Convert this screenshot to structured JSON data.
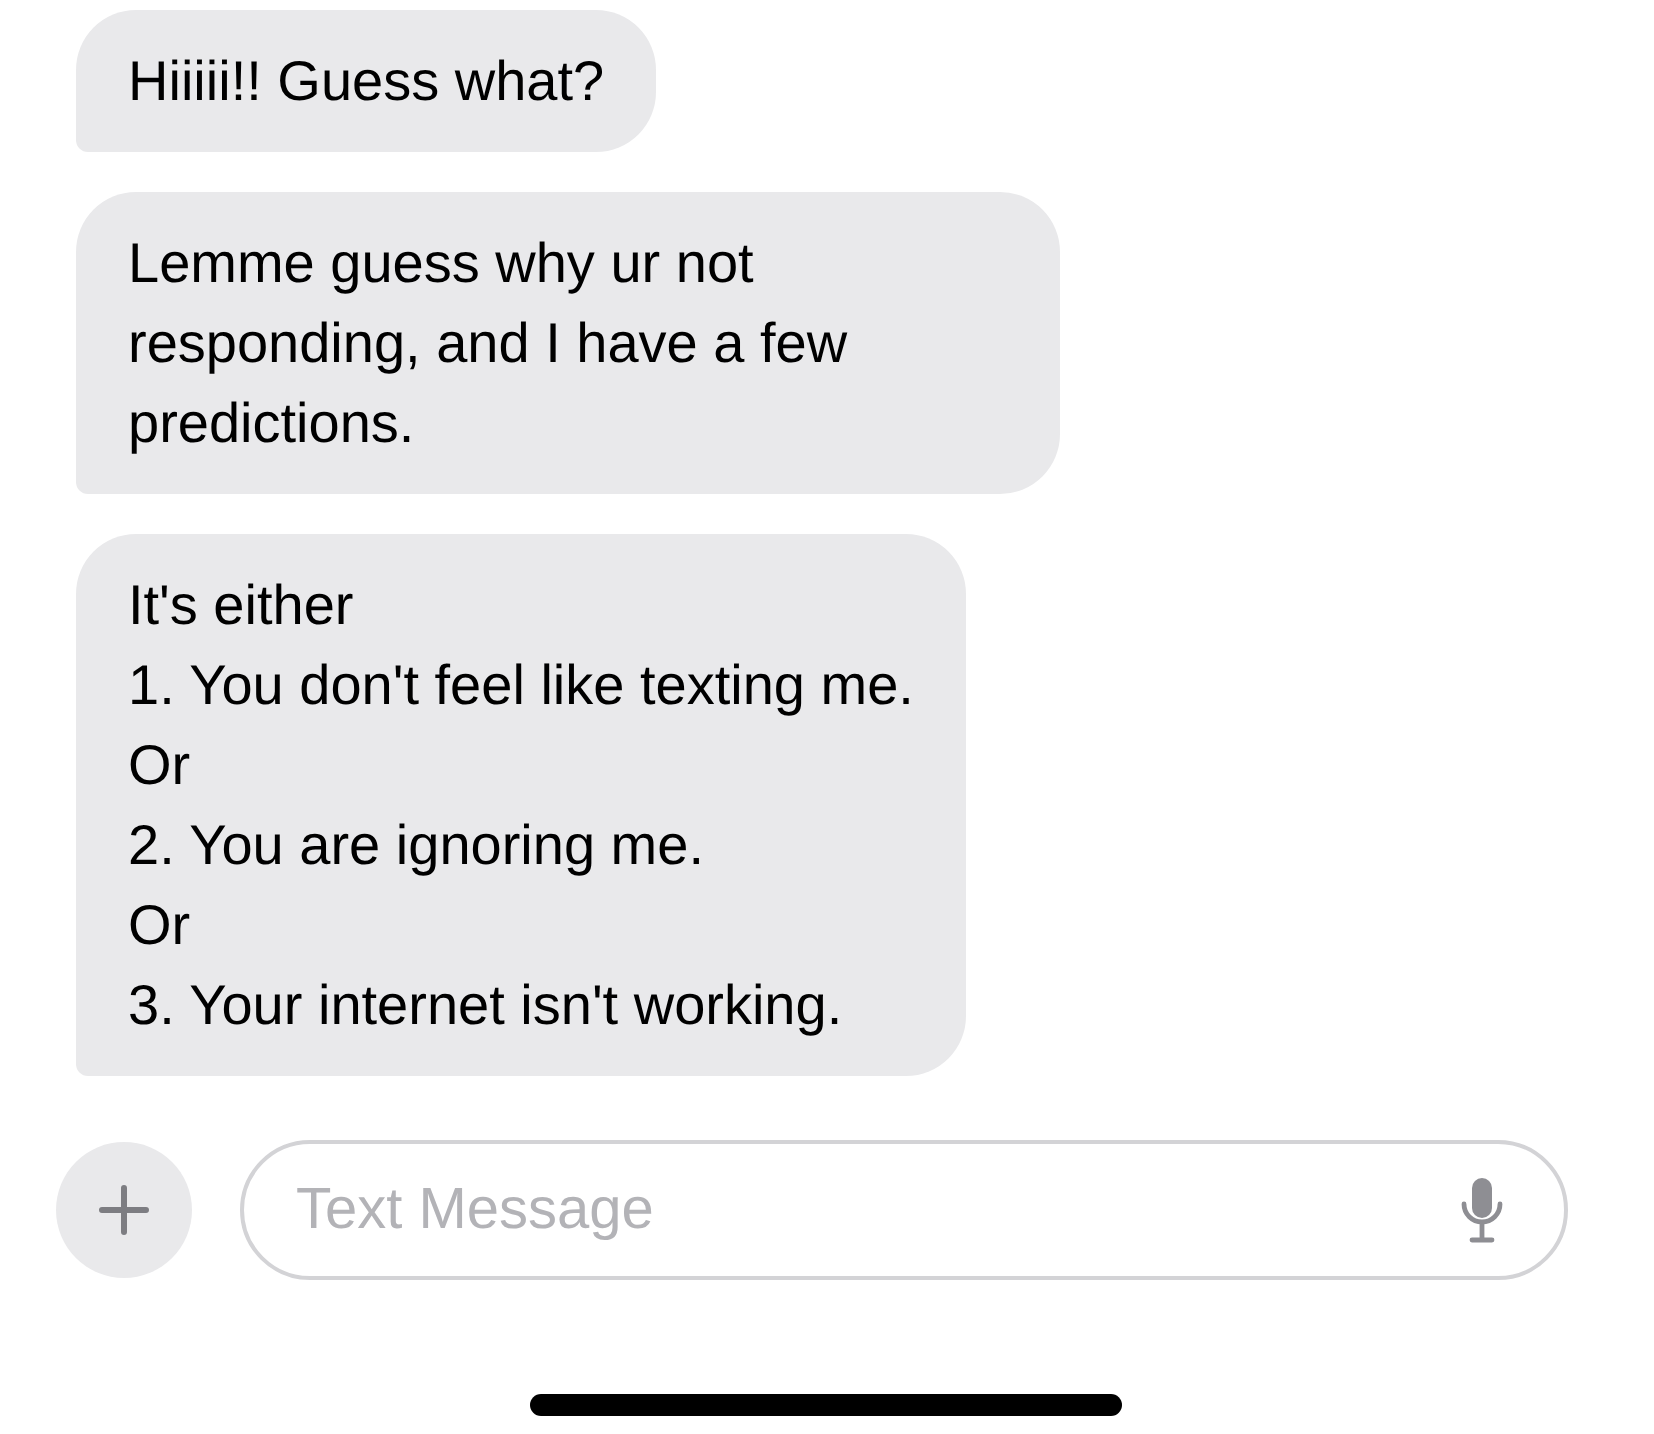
{
  "messages": [
    {
      "text": "Hiiiii!! Guess what?"
    },
    {
      "text": "Lemme guess why ur not responding, and I have a few predictions."
    },
    {
      "text": "It's either\n1. You don't feel like texting me.\nOr\n2. You are ignoring me.\nOr\n3. Your internet isn't working."
    }
  ],
  "composer": {
    "placeholder": "Text Message"
  }
}
